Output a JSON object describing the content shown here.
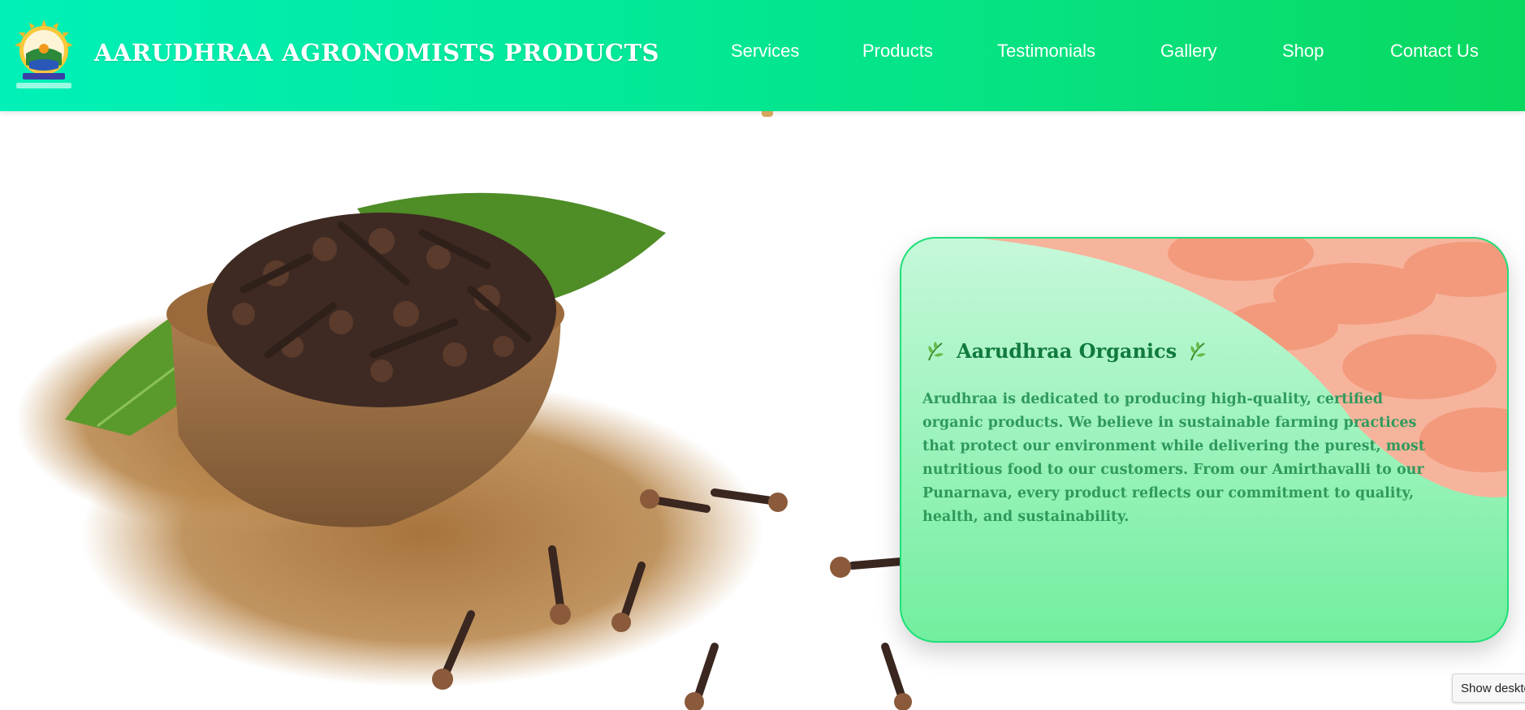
{
  "header": {
    "brand": "AARUDHRAA AGRONOMISTS PRODUCTS",
    "logo_icon": "aarudhraa-organics-logo",
    "nav": [
      {
        "label": "Services"
      },
      {
        "label": "Products"
      },
      {
        "label": "Testimonials"
      },
      {
        "label": "Gallery"
      },
      {
        "label": "Shop"
      },
      {
        "label": "Contact Us"
      }
    ]
  },
  "hero": {
    "image": "cloves-bowl-image"
  },
  "card": {
    "title": "Aarudhraa Organics",
    "title_icon": "leaf-icon",
    "description": "Arudhraa is dedicated to producing high-quality, certified organic products. We believe in sustainable farming practices that protect our environment while delivering the purest, most nutritious food to our customers. From our Amirthavalli to our Punarnava, every product reflects our commitment to quality, health, and sustainability."
  },
  "desktop_button": {
    "label": "Show desktop"
  },
  "colors": {
    "header_start": "#00f0b8",
    "header_end": "#0ad85e",
    "card_title": "#107a3c",
    "card_text": "#2f9a5c"
  }
}
